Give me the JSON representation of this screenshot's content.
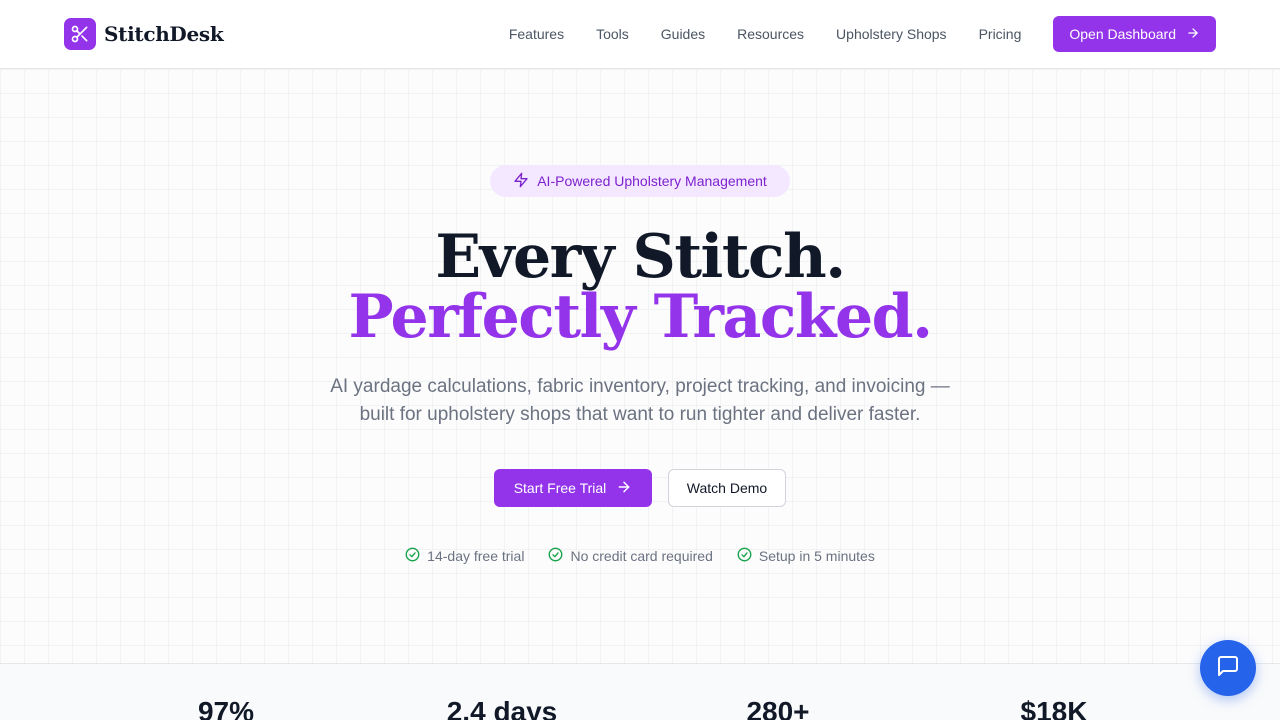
{
  "brand": {
    "name": "StitchDesk",
    "logo_icon": "scissors-icon",
    "accent": "#9333ea"
  },
  "nav": {
    "links": [
      "Features",
      "Tools",
      "Guides",
      "Resources",
      "Upholstery Shops",
      "Pricing"
    ],
    "cta_label": "Open Dashboard"
  },
  "hero": {
    "badge": "AI-Powered Upholstery Management",
    "headline_line1": "Every Stitch.",
    "headline_line2": "Perfectly Tracked.",
    "subtitle_line1": "AI yardage calculations, fabric inventory, project tracking, and invoicing —",
    "subtitle_line2": "built for upholstery shops that want to run tighter and deliver faster.",
    "primary_cta": "Start Free Trial",
    "secondary_cta": "Watch Demo",
    "perks": [
      "14-day free trial",
      "No credit card required",
      "Setup in 5 minutes"
    ]
  },
  "stats": [
    "97%",
    "2.4 days",
    "280+",
    "$18K"
  ],
  "chat": {
    "icon": "chat-bubble-icon",
    "color": "#2563eb"
  }
}
